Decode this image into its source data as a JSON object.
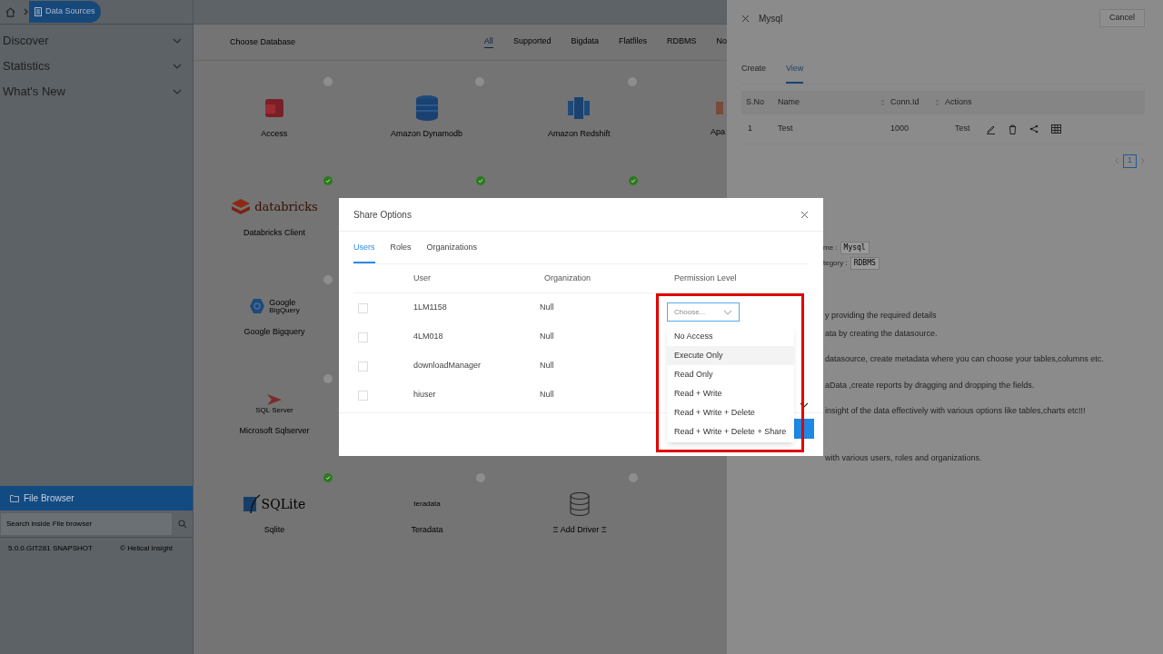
{
  "breadcrumb": {
    "current": "Data Sources"
  },
  "sidebar": {
    "items": [
      {
        "label": "Discover",
        "expanded": false
      },
      {
        "label": "Statistics",
        "expanded": false
      },
      {
        "label": "What's New",
        "expanded": false
      }
    ],
    "file_browser": {
      "title": "File Browser",
      "search_placeholder": "Search inside File browser"
    },
    "version": "5.0.0.GIT281 SNAPSHOT",
    "brand": "© Helical Insight"
  },
  "catalog": {
    "title": "Choose Database",
    "tabs": [
      {
        "label": "All",
        "selected": true
      },
      {
        "label": "Supported",
        "selected": false
      },
      {
        "label": "Bigdata",
        "selected": false
      },
      {
        "label": "Flatfiles",
        "selected": false
      },
      {
        "label": "RDBMS",
        "selected": false
      },
      {
        "label": "No",
        "selected": false
      }
    ],
    "rows": [
      [
        {
          "kind": "access",
          "label": "Access",
          "connected": false
        },
        {
          "kind": "dynamodb",
          "label": "Amazon Dynamodb",
          "connected": false
        },
        {
          "kind": "redshift",
          "label": "Amazon Redshift",
          "connected": false
        },
        {
          "kind": "partial",
          "label": "Apa"
        }
      ],
      [
        {
          "kind": "databricks",
          "label": "Databricks Client",
          "logo_text": "databricks",
          "connected": true
        },
        {
          "kind": "covered",
          "connected": true
        },
        {
          "kind": "covered",
          "connected": true
        }
      ],
      [
        {
          "kind": "bigquery",
          "label": "Google Bigquery",
          "logo_text": "Google",
          "logo_subtext": "BigQuery",
          "connected": false
        }
      ],
      [
        {
          "kind": "sqlserver",
          "label": "Microsoft Sqlserver",
          "logo_text": "SQL Server",
          "connected": false
        }
      ],
      [
        {
          "kind": "sqlite",
          "label": "Sqlite",
          "logo_text": "SQLite",
          "connected": true
        },
        {
          "kind": "teradata",
          "label": "Teradata",
          "logo_text": "teradata",
          "connected": false
        },
        {
          "kind": "driver",
          "label": "Ξ Add Driver Ξ",
          "connected": false
        }
      ]
    ]
  },
  "drawer": {
    "title": "Mysql",
    "cancel": "Cancel",
    "tabs": [
      {
        "label": "Create",
        "selected": false
      },
      {
        "label": "View",
        "selected": true
      }
    ],
    "table": {
      "columns": [
        "S.No",
        "Name",
        "Conn.Id",
        "Actions"
      ],
      "rows": [
        {
          "sno": "1",
          "name": "Test",
          "conn_id": "1000",
          "actions": "Test"
        }
      ]
    },
    "page": "1",
    "details": [
      {
        "label": "me :",
        "tag": "Mysql"
      },
      {
        "label": "tegory :",
        "tag": "RDBMS"
      }
    ],
    "lines": [
      "y providing the required details",
      "ata by creating the datasource.",
      "datasource, create metadata where you can choose your tables,columns etc.",
      "aData ,create reports by dragging and dropping the fields.",
      "insight of the data effectively with various options like tables,charts etc!!!",
      "with various users, roles and organizations."
    ]
  },
  "modal": {
    "title": "Share Options",
    "tabs": [
      {
        "label": "Users",
        "selected": true
      },
      {
        "label": "Roles",
        "selected": false
      },
      {
        "label": "Organizations",
        "selected": false
      }
    ],
    "columns": [
      "User",
      "Organization",
      "Permission Level"
    ],
    "rows": [
      {
        "user": "1LM1158",
        "organization": "Null",
        "checked": false
      },
      {
        "user": "4LM018",
        "organization": "Null",
        "checked": false
      },
      {
        "user": "downloadManager",
        "organization": "Null",
        "checked": false
      },
      {
        "user": "hiuser",
        "organization": "Null",
        "checked": false
      }
    ],
    "select": {
      "placeholder": "Choose..."
    },
    "options": [
      {
        "label": "No Access",
        "selected": false
      },
      {
        "label": "Execute Only",
        "selected": true
      },
      {
        "label": "Read Only",
        "selected": false
      },
      {
        "label": "Read + Write",
        "selected": false
      },
      {
        "label": "Read + Write + Delete",
        "selected": false
      },
      {
        "label": "Read + Write + Delete + Share",
        "selected": false
      }
    ]
  }
}
